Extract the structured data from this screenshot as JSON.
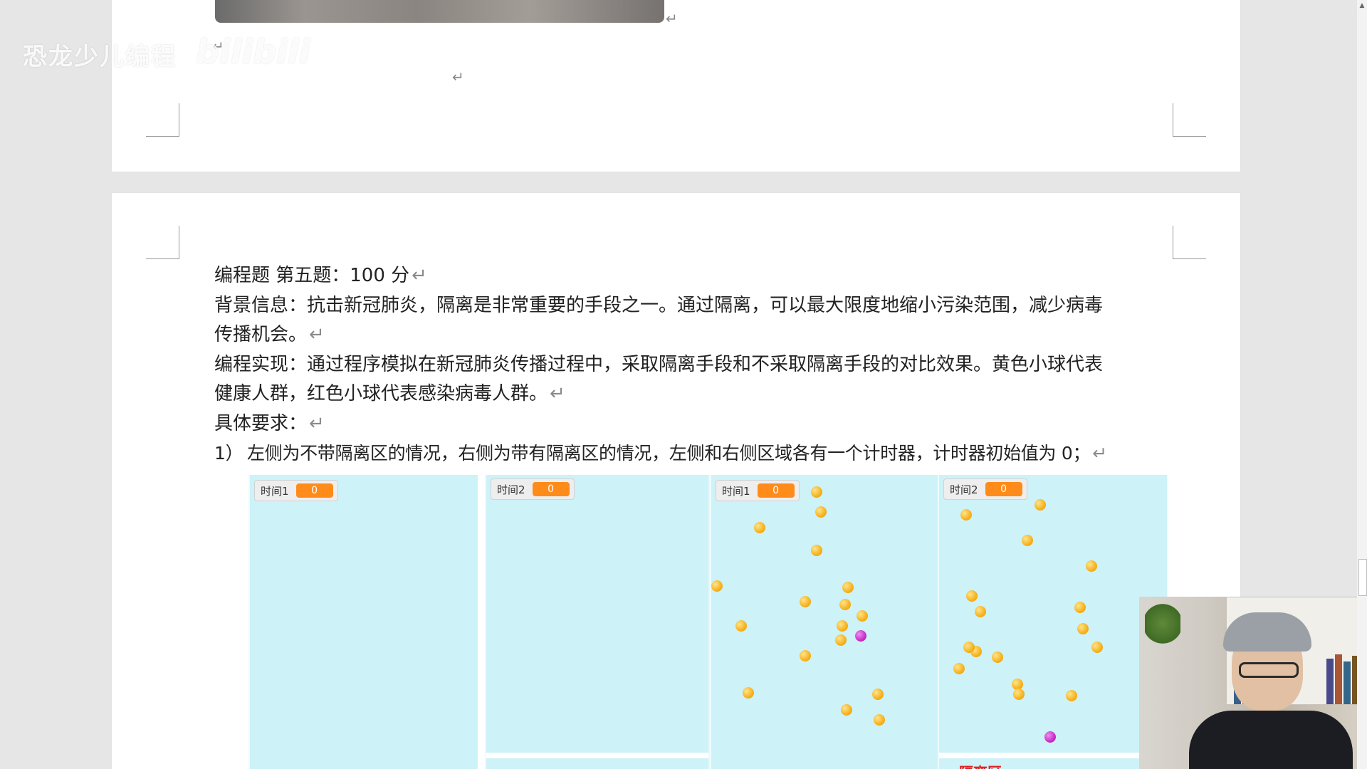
{
  "watermark": {
    "channel": "恐龙少儿编程",
    "logo": "bilibili"
  },
  "document": {
    "para_mark": "↵",
    "heading": "编程题  第五题：100 分",
    "background_line1": "背景信息：抗击新冠肺炎，隔离是非常重要的手段之一。通过隔离，可以最大限度地缩小污染范围，减少病毒",
    "background_line2": "传播机会。",
    "impl_line1": "编程实现：通过程序模拟在新冠肺炎传播过程中，采取隔离手段和不采取隔离手段的对比效果。黄色小球代表",
    "impl_line2": "健康人群，红色小球代表感染病毒人群。",
    "requirements": "具体要求：",
    "item1_num": "1）",
    "item1_text": "左侧为不带隔离区的情况，右侧为带有隔离区的情况，左侧和右侧区域各有一个计时器，计时器初始值为 0；"
  },
  "figure": {
    "stages": [
      {
        "label": "时间1",
        "value": "0"
      },
      {
        "label": "时间2",
        "value": "0"
      },
      {
        "label": "时间1",
        "value": "0"
      },
      {
        "label": "时间2",
        "value": "0"
      }
    ],
    "zone_label": "隔离区",
    "colors": {
      "stage_bg": "#cdf2f8",
      "healthy": "#f6b11c",
      "infected": "#c82fc8",
      "timer": "#ff8c1a"
    }
  }
}
